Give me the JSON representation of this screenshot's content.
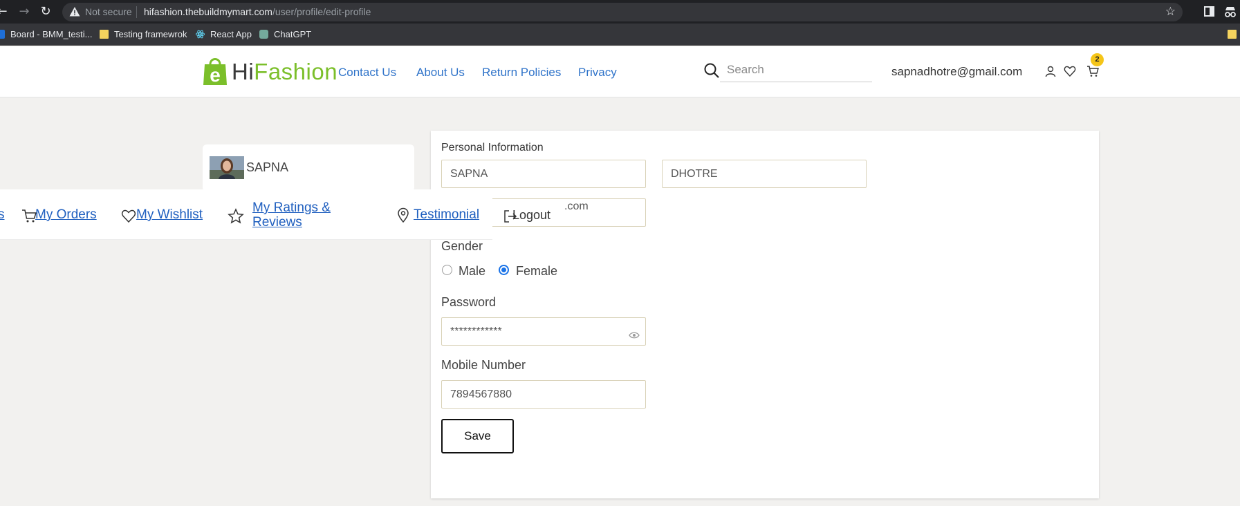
{
  "browser": {
    "security_label": "Not secure",
    "url_host": "hifashion.thebuildmymart.com",
    "url_path": "/user/profile/edit-profile",
    "bookmarks": [
      "Board - BMM_testi...",
      "Testing framewrok",
      "React App",
      "ChatGPT"
    ]
  },
  "header": {
    "logo_hi": "Hi",
    "logo_fashion": "Fashion",
    "logo_letter": "e",
    "nav": [
      "Contact Us",
      "About Us",
      "Return Policies",
      "Privacy"
    ],
    "search_placeholder": "Search",
    "user_email": "sapnadhotre@gmail.com",
    "cart_count": "2",
    "accent_color": "#7bbf2a",
    "link_color": "#2f73c9"
  },
  "profile": {
    "name": "SAPNA"
  },
  "account_nav": {
    "cut_item": "s",
    "orders": "My Orders",
    "wishlist": "My Wishlist",
    "ratings_line1": "My Ratings &",
    "ratings_line2": "Reviews",
    "testimonial": "Testimonial",
    "logout": "Logout"
  },
  "form": {
    "section_title": "Personal Information",
    "first_name": "SAPNA",
    "last_name": "DHOTRE",
    "email_visible_part": ".com",
    "gender_label": "Gender",
    "gender_options": [
      "Male",
      "Female"
    ],
    "gender_selected": "Female",
    "password_label": "Password",
    "password_value": "************",
    "mobile_label": "Mobile Number",
    "mobile_value": "7894567880",
    "save_label": "Save"
  }
}
